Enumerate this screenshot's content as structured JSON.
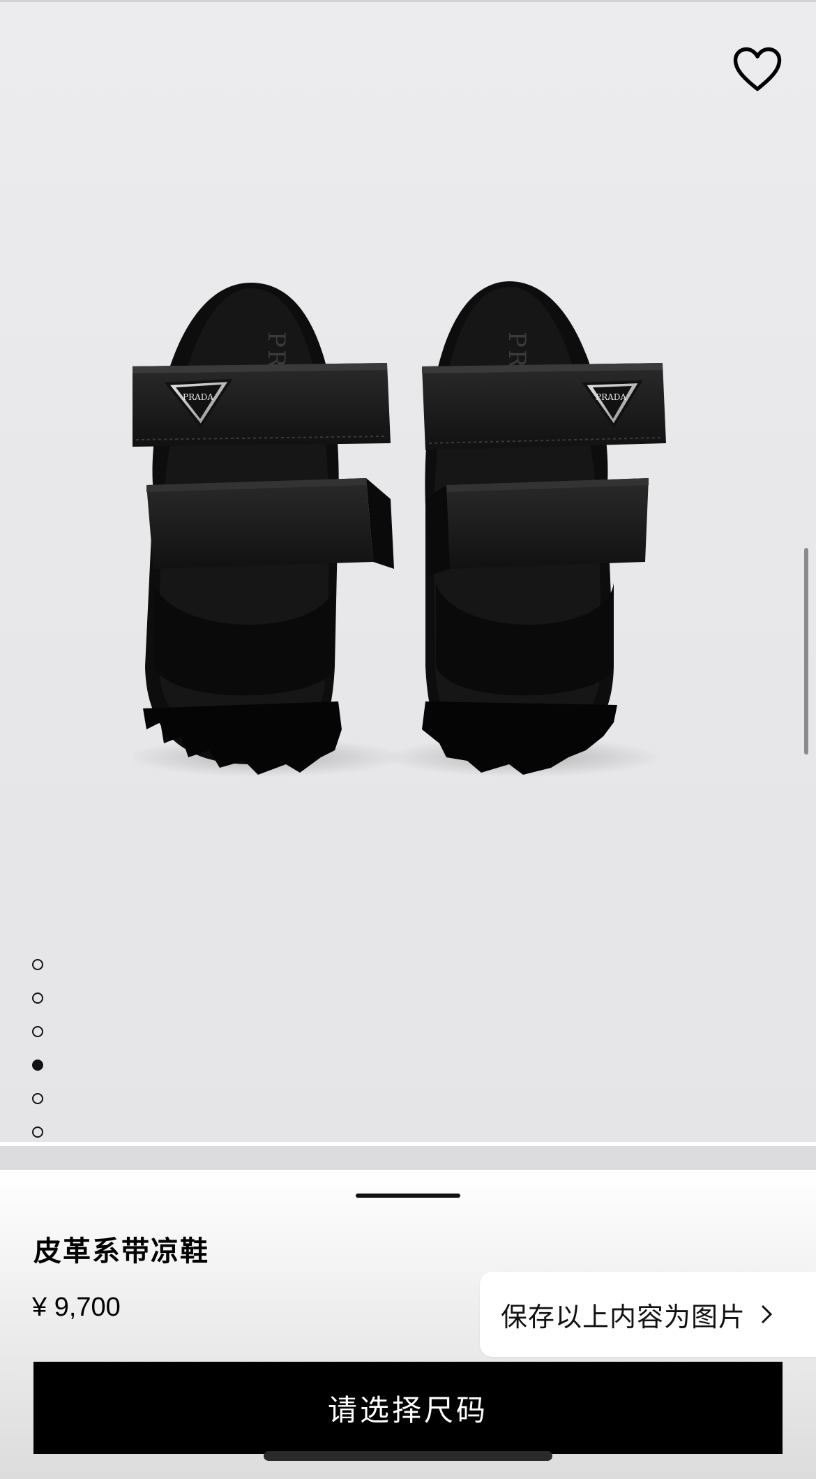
{
  "product": {
    "name": "皮革系带凉鞋",
    "price": "¥ 9,700",
    "image_logo_text": "PRADA"
  },
  "actions": {
    "select_size_label": "请选择尺码",
    "save_image_label": "保存以上内容为图片"
  },
  "carousel": {
    "total_images": 6,
    "active_index": 3
  },
  "icons": {
    "favorite": "heart-outline-icon",
    "save_chevron": "chevron-right-icon"
  },
  "colors": {
    "primary_button": "#000000",
    "primary_button_text": "#ffffff",
    "hero_background": "#e8e8ea"
  }
}
